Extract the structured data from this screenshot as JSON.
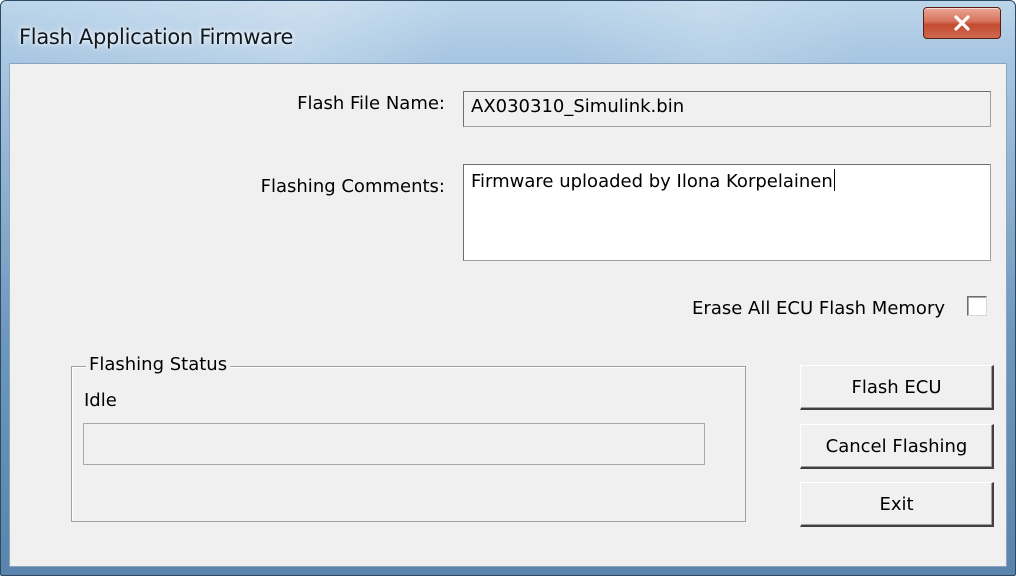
{
  "window": {
    "title": "Flash Application Firmware",
    "close_icon": "close-x-icon"
  },
  "form": {
    "flash_file_label": "Flash File Name:",
    "flash_file_value": "AX030310_Simulink.bin",
    "comments_label": "Flashing Comments:",
    "comments_value": "Firmware uploaded by Ilona Korpelainen",
    "erase_label": "Erase All ECU Flash Memory",
    "erase_checked": false
  },
  "status": {
    "group_label": "Flashing Status",
    "state_text": "Idle",
    "progress_percent": 0,
    "progress_color": "#06b025"
  },
  "buttons": {
    "flash_label": "Flash ECU",
    "cancel_label": "Cancel Flashing",
    "exit_label": "Exit"
  },
  "colors": {
    "dialog_background": "#f0f0f0",
    "close_button": "#c24a2f",
    "titlebar": "#6d96bb"
  }
}
